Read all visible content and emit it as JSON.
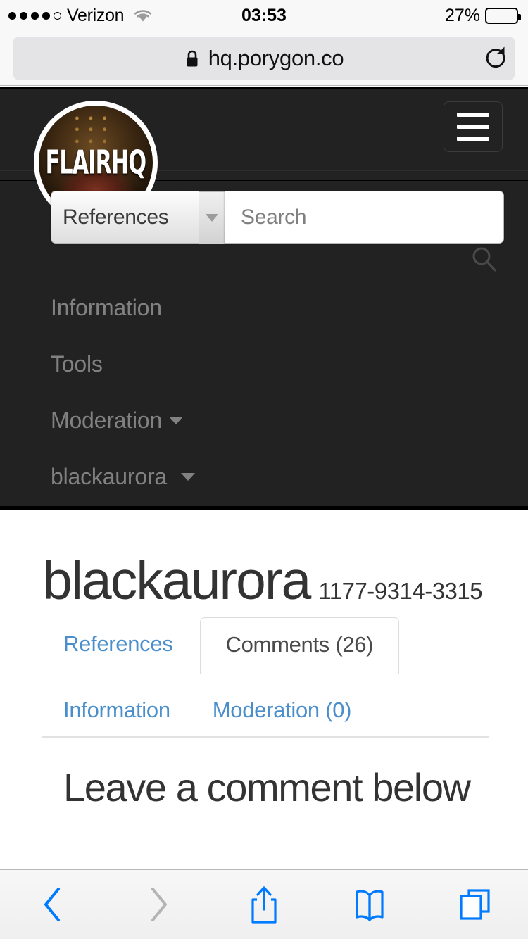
{
  "status_bar": {
    "carrier": "Verizon",
    "signal_dots_filled": 4,
    "signal_dots_total": 5,
    "time": "03:53",
    "battery_percent": "27%",
    "battery_level": 27,
    "wifi_icon": "wifi-icon"
  },
  "browser": {
    "url": "hq.porygon.co",
    "lock_icon": "lock-icon",
    "reload_icon": "reload-icon",
    "toolbar": [
      {
        "name": "back-button",
        "icon": "chevron-left-icon",
        "enabled": true
      },
      {
        "name": "forward-button",
        "icon": "chevron-right-icon",
        "enabled": false
      },
      {
        "name": "share-button",
        "icon": "share-icon",
        "enabled": true
      },
      {
        "name": "bookmarks-button",
        "icon": "book-icon",
        "enabled": true
      },
      {
        "name": "tabs-button",
        "icon": "tabs-icon",
        "enabled": true
      }
    ]
  },
  "site_header": {
    "logo_text": "FLAIRHQ",
    "menu_icon": "hamburger-icon",
    "search": {
      "scope_label": "References",
      "scope_caret": "caret-down-icon",
      "placeholder": "Search",
      "value": "",
      "search_icon": "search-icon"
    },
    "nav": [
      {
        "label": "Information",
        "has_caret": false
      },
      {
        "label": "Tools",
        "has_caret": false
      },
      {
        "label": "Moderation",
        "has_caret": true
      },
      {
        "label": "blackaurora",
        "has_caret": true
      }
    ]
  },
  "page": {
    "title": "blackaurora",
    "friend_code": "1177-9314-3315",
    "tabs_row_one": [
      {
        "label": "References",
        "active": false
      },
      {
        "label": "Comments (26)",
        "active": true
      }
    ],
    "tabs_row_two": [
      {
        "label": "Information",
        "active": false
      },
      {
        "label": "Moderation (0)",
        "active": false
      }
    ],
    "section_heading": "Leave a comment below"
  },
  "colors": {
    "header_bg": "#222222",
    "link_blue": "#4a8fcc",
    "ios_blue": "#007aff",
    "text_dark": "#333333",
    "nav_text": "#818181",
    "status_bg": "#f8f8f8",
    "urlfield_bg": "#e4e4e6"
  }
}
